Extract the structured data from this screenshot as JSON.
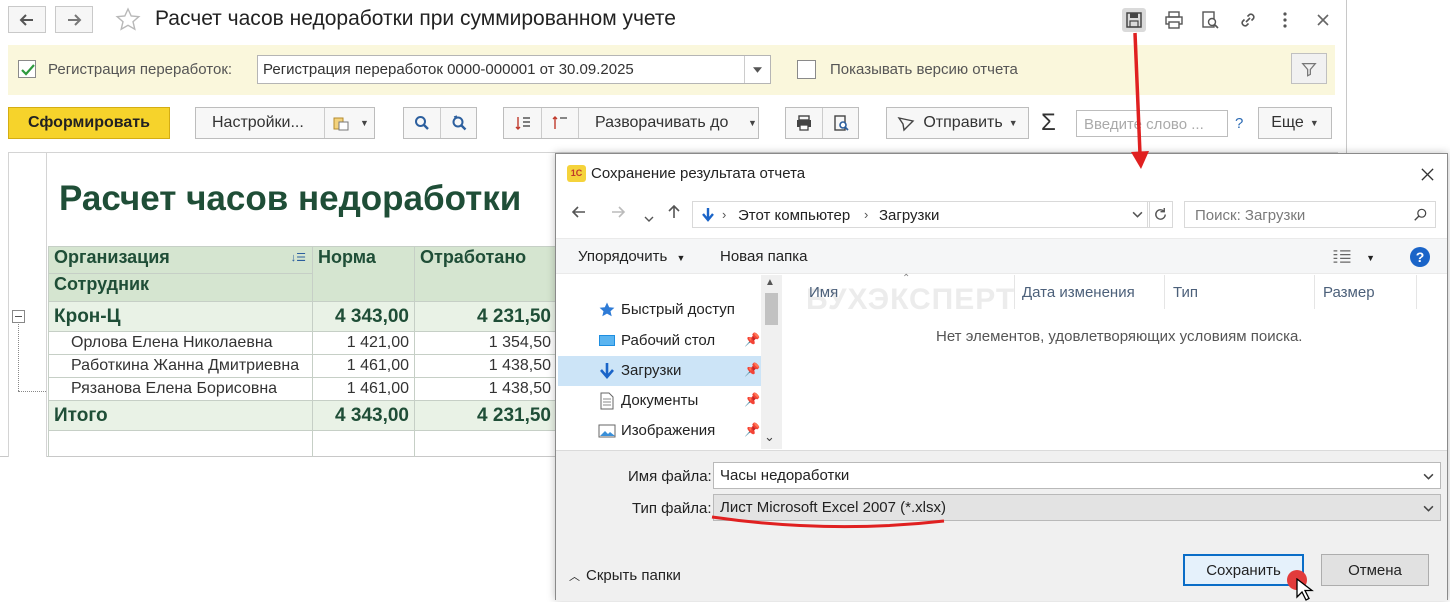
{
  "main": {
    "title": "Расчет часов недоработки при суммированном учете",
    "params": {
      "registration_label": "Регистрация переработок:",
      "registration_value": "Регистрация переработок 0000-000001 от 30.09.2025",
      "registration_checked": true,
      "show_version_label": "Показывать версию отчета",
      "show_version_checked": false
    },
    "toolbar": {
      "generate": "Сформировать",
      "settings": "Настройки...",
      "expand_to": "Разворачивать до",
      "send": "Отправить",
      "search_placeholder": "Введите слово ...",
      "help": "?",
      "more": "Еще"
    },
    "report": {
      "title": "Расчет часов недоработки",
      "headers": {
        "org": "Организация",
        "employee": "Сотрудник",
        "norm": "Норма",
        "worked": "Отработано"
      },
      "group": {
        "name": "Крон-Ц",
        "norm": "4 343,00",
        "worked": "4 231,50"
      },
      "rows": [
        {
          "name": "Орлова Елена Николаевна",
          "norm": "1 421,00",
          "worked": "1 354,50"
        },
        {
          "name": "Работкина Жанна Дмитриевна",
          "norm": "1 461,00",
          "worked": "1 438,50"
        },
        {
          "name": "Рязанова Елена Борисовна",
          "norm": "1 461,00",
          "worked": "1 438,50"
        }
      ],
      "total": {
        "name": "Итого",
        "norm": "4 343,00",
        "worked": "4 231,50"
      }
    }
  },
  "dialog": {
    "logo": "1С",
    "title": "Сохранение результата отчета",
    "path": [
      "Этот компьютер",
      "Загрузки"
    ],
    "search_placeholder": "Поиск: Загрузки",
    "organize": "Упорядочить",
    "new_folder": "Новая папка",
    "help": "?",
    "nav_items": [
      {
        "label": "Быстрый доступ",
        "icon": "star-icon"
      },
      {
        "label": "Рабочий стол",
        "icon": "desktop-icon"
      },
      {
        "label": "Загрузки",
        "icon": "download-icon"
      },
      {
        "label": "Документы",
        "icon": "document-icon"
      },
      {
        "label": "Изображения",
        "icon": "image-icon"
      }
    ],
    "columns": [
      "Имя",
      "Дата изменения",
      "Тип",
      "Размер"
    ],
    "empty_message": "Нет элементов, удовлетворяющих условиям поиска.",
    "watermark": "БУХЭКСПЕРТ",
    "file_name_label": "Имя файла:",
    "file_name_value": "Часы недоработки",
    "file_type_label": "Тип файла:",
    "file_type_value": "Лист Microsoft Excel 2007 (*.xlsx)",
    "hide_folders": "Скрыть папки",
    "save": "Сохранить",
    "cancel": "Отмена"
  },
  "colors": {
    "accent_yellow": "#f6d32b",
    "report_green": "#1f4e37",
    "annotation_red": "#e02020",
    "dialog_blue": "#0a6dc7"
  }
}
